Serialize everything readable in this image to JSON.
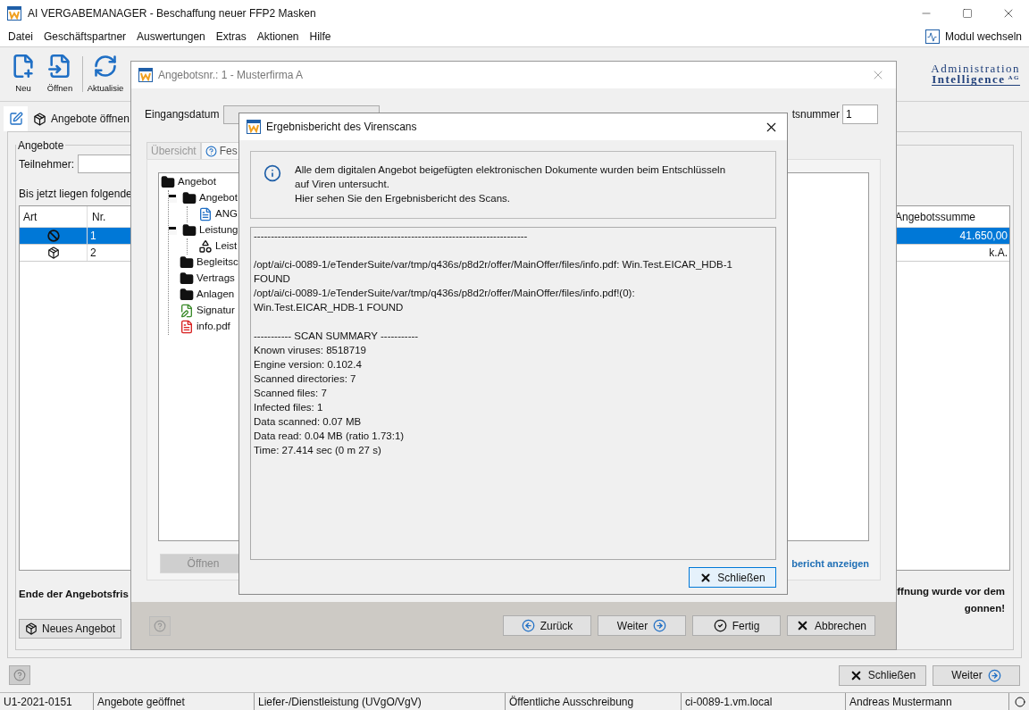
{
  "window": {
    "title": "AI VERGABEMANAGER - Beschaffung neuer FFP2 Masken"
  },
  "menu": [
    "Datei",
    "Geschäftspartner",
    "Auswertungen",
    "Extras",
    "Aktionen",
    "Hilfe"
  ],
  "module_switch": "Modul wechseln",
  "toolbar": [
    {
      "label": "Neu",
      "kind": "new"
    },
    {
      "label": "Öffnen",
      "kind": "open"
    },
    {
      "label": "Aktualisie",
      "kind": "refresh"
    }
  ],
  "logo": {
    "line_1": "Administration",
    "line_2": "Intelligence",
    "suffix": "AG"
  },
  "view_tab": {
    "label": "Angebote öffnen",
    "selected": true
  },
  "group": {
    "title": "Angebote",
    "participant_label": "Teilnehmer:",
    "intro": "Bis jetzt liegen folgende"
  },
  "table": {
    "columns": [
      "Art",
      "Nr.",
      "Angebotssumme"
    ],
    "rows": [
      {
        "kind": "blocked",
        "nr": "1",
        "sum": "41.650,00",
        "selected": true
      },
      {
        "kind": "package",
        "nr": "2",
        "sum": "k.A.",
        "selected": false
      }
    ]
  },
  "deadline_note": "Ende der Angebotsfris",
  "warning_lines": [
    "ffnung wurde vor dem",
    "gonnen!"
  ],
  "panel_buttons": [
    "Neues Angebot"
  ],
  "footer_buttons": [
    {
      "label": "Schließen",
      "kind": "close"
    },
    {
      "label": "Weiter",
      "kind": "next"
    }
  ],
  "status_bar": [
    "U1-2021-0151",
    "Angebote geöffnet",
    "Liefer-/Dienstleistung (UVgO/VgV)",
    "Öffentliche Ausschreibung",
    "ci-0089-1.vm.local",
    "Andreas Mustermann"
  ],
  "offer_dialog": {
    "title": "Angebotsnr.: 1 - Musterfirma A",
    "date_label": "Eingangsdatum",
    "number_label": "tsnummer",
    "number_value": "1",
    "tabs": [
      {
        "label": "Übersicht",
        "selected": false
      },
      {
        "label": "Fes",
        "selected": true
      }
    ],
    "tree": [
      {
        "label": "Angebot",
        "kind": "folder",
        "children": [
          {
            "label": "Angebot",
            "kind": "folder",
            "expanded": true,
            "children": [
              {
                "label": "ANG",
                "kind": "document"
              }
            ]
          },
          {
            "label": "Leistung",
            "kind": "folder",
            "expanded": true,
            "children": [
              {
                "label": "Leist",
                "kind": "shapes"
              }
            ]
          },
          {
            "label": "Begleitsc",
            "kind": "folder"
          },
          {
            "label": "Vertrags",
            "kind": "folder"
          },
          {
            "label": "Anlagen",
            "kind": "folder"
          },
          {
            "label": "Signatur",
            "kind": "signature"
          },
          {
            "label": "info.pdf",
            "kind": "pdf"
          }
        ]
      }
    ],
    "open_button": {
      "label": "Öffnen",
      "disabled": true
    },
    "report_link": "bericht anzeigen",
    "nav_buttons": [
      {
        "label": "Zurück",
        "kind": "back"
      },
      {
        "label": "Weiter",
        "kind": "next"
      },
      {
        "label": "Fertig",
        "kind": "done"
      },
      {
        "label": "Abbrechen",
        "kind": "cancel"
      }
    ]
  },
  "scan_dialog": {
    "title": "Ergebnisbericht des Virenscans",
    "info_lines": [
      "Alle dem digitalen Angebot beigefügten elektronischen Dokumente wurden beim Entschlüsseln",
      "auf Viren untersucht.",
      "Hier sehen Sie den Ergebnisbericht des Scans."
    ],
    "report_blocks": [
      [
        "--------------------------------------------------------------------------------"
      ],
      [
        "/opt/ai/ci-0089-1/eTenderSuite/var/tmp/q436s/p8d2r/offer/MainOffer/files/info.pdf: Win.Test.EICAR_HDB-1",
        "FOUND",
        "/opt/ai/ci-0089-1/eTenderSuite/var/tmp/q436s/p8d2r/offer/MainOffer/files/info.pdf!(0):",
        "Win.Test.EICAR_HDB-1 FOUND"
      ],
      [
        "----------- SCAN SUMMARY -----------",
        "Known viruses: 8518719",
        "Engine version: 0.102.4",
        "Scanned directories: 7",
        "Scanned files: 7",
        "Infected files: 1",
        "Data scanned: 0.07 MB",
        "Data read: 0.04 MB (ratio 1.73:1)",
        "Time: 27.414 sec (0 m 27 s)"
      ]
    ],
    "close_button": "Schließen"
  }
}
